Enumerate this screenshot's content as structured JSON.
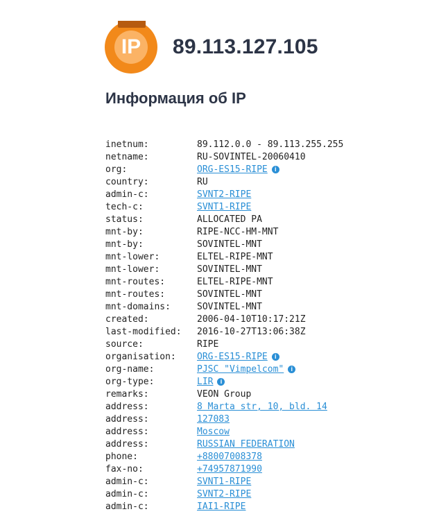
{
  "header": {
    "logo_text": "IP",
    "ip_address": "89.113.127.105"
  },
  "section": {
    "title": "Информация об IP"
  },
  "colors": {
    "accent_orange": "#f2891a",
    "link_blue": "#2a8fd6",
    "heading": "#2c3446"
  },
  "whois": [
    {
      "key": "inetnum:",
      "value": "89.112.0.0 - 89.113.255.255",
      "link": false,
      "info": false
    },
    {
      "key": "netname:",
      "value": "RU-SOVINTEL-20060410",
      "link": false,
      "info": false
    },
    {
      "key": "org:",
      "value": "ORG-ES15-RIPE",
      "link": true,
      "info": true
    },
    {
      "key": "country:",
      "value": "RU",
      "link": false,
      "info": false
    },
    {
      "key": "admin-c:",
      "value": "SVNT2-RIPE",
      "link": true,
      "info": false
    },
    {
      "key": "tech-c:",
      "value": "SVNT1-RIPE",
      "link": true,
      "info": false
    },
    {
      "key": "status:",
      "value": "ALLOCATED PA",
      "link": false,
      "info": false
    },
    {
      "key": "mnt-by:",
      "value": "RIPE-NCC-HM-MNT",
      "link": false,
      "info": false
    },
    {
      "key": "mnt-by:",
      "value": "SOVINTEL-MNT",
      "link": false,
      "info": false
    },
    {
      "key": "mnt-lower:",
      "value": "ELTEL-RIPE-MNT",
      "link": false,
      "info": false
    },
    {
      "key": "mnt-lower:",
      "value": "SOVINTEL-MNT",
      "link": false,
      "info": false
    },
    {
      "key": "mnt-routes:",
      "value": "ELTEL-RIPE-MNT",
      "link": false,
      "info": false
    },
    {
      "key": "mnt-routes:",
      "value": "SOVINTEL-MNT",
      "link": false,
      "info": false
    },
    {
      "key": "mnt-domains:",
      "value": "SOVINTEL-MNT",
      "link": false,
      "info": false
    },
    {
      "key": "created:",
      "value": "2006-04-10T10:17:21Z",
      "link": false,
      "info": false
    },
    {
      "key": "last-modified:",
      "value": "2016-10-27T13:06:38Z",
      "link": false,
      "info": false
    },
    {
      "key": "source:",
      "value": "RIPE",
      "link": false,
      "info": false
    },
    {
      "key": "organisation:",
      "value": "ORG-ES15-RIPE",
      "link": true,
      "info": true
    },
    {
      "key": "org-name:",
      "value": "PJSC \"Vimpelcom\"",
      "link": true,
      "info": true
    },
    {
      "key": "org-type:",
      "value": "LIR",
      "link": true,
      "info": true
    },
    {
      "key": "remarks:",
      "value": "VEON Group",
      "link": false,
      "info": false
    },
    {
      "key": "address:",
      "value": "8 Marta str, 10, bld. 14",
      "link": true,
      "info": false
    },
    {
      "key": "address:",
      "value": "127083",
      "link": true,
      "info": false
    },
    {
      "key": "address:",
      "value": "Moscow",
      "link": true,
      "info": false
    },
    {
      "key": "address:",
      "value": "RUSSIAN FEDERATION",
      "link": true,
      "info": false
    },
    {
      "key": "phone:",
      "value": "+88007008378",
      "link": true,
      "info": false
    },
    {
      "key": "fax-no:",
      "value": "+74957871990",
      "link": true,
      "info": false
    },
    {
      "key": "admin-c:",
      "value": "SVNT1-RIPE",
      "link": true,
      "info": false
    },
    {
      "key": "admin-c:",
      "value": "SVNT2-RIPE",
      "link": true,
      "info": false
    },
    {
      "key": "admin-c:",
      "value": "IAI1-RIPE",
      "link": true,
      "info": false
    }
  ],
  "info_icon_glyph": "i"
}
